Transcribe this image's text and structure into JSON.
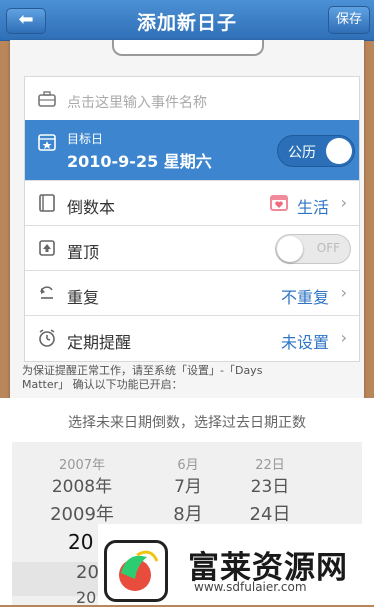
{
  "header": {
    "back_icon": "back-arrow-icon",
    "title": "添加新日子",
    "save_label": "保存"
  },
  "form": {
    "event_name_placeholder": "点击这里输入事件名称",
    "target_date": {
      "label": "目标日",
      "value": "2010-9-25 星期六",
      "calendar_toggle_label": "公历"
    },
    "rows": [
      {
        "label": "倒数本",
        "value": "生活",
        "icon": "notebook-icon"
      },
      {
        "label": "置顶",
        "toggle_label": "OFF",
        "icon": "pin-top-icon"
      },
      {
        "label": "重复",
        "value": "不重复",
        "icon": "repeat-icon"
      },
      {
        "label": "定期提醒",
        "value": "未设置",
        "icon": "alarm-clock-icon"
      }
    ],
    "note_line1": "为保证提醒正常工作，请至系统「设置」-「Days",
    "note_line2": "Matter」 确认以下功能已开启："
  },
  "picker": {
    "hint": "选择未来日期倒数，选择过去日期正数",
    "years": [
      "2007年",
      "2008年",
      "2009年",
      "20",
      "20",
      "20"
    ],
    "months": [
      "6月",
      "7月",
      "8月"
    ],
    "days": [
      "22日",
      "23日",
      "24日"
    ]
  },
  "watermark": {
    "brand": "富莱资源网",
    "url": "www.sdfulaier.com"
  },
  "colors": {
    "header": "#3a7fc8",
    "selected_row": "#3d86cf",
    "link_value": "#2f75c6",
    "annotation_arrow": "#e02020"
  }
}
